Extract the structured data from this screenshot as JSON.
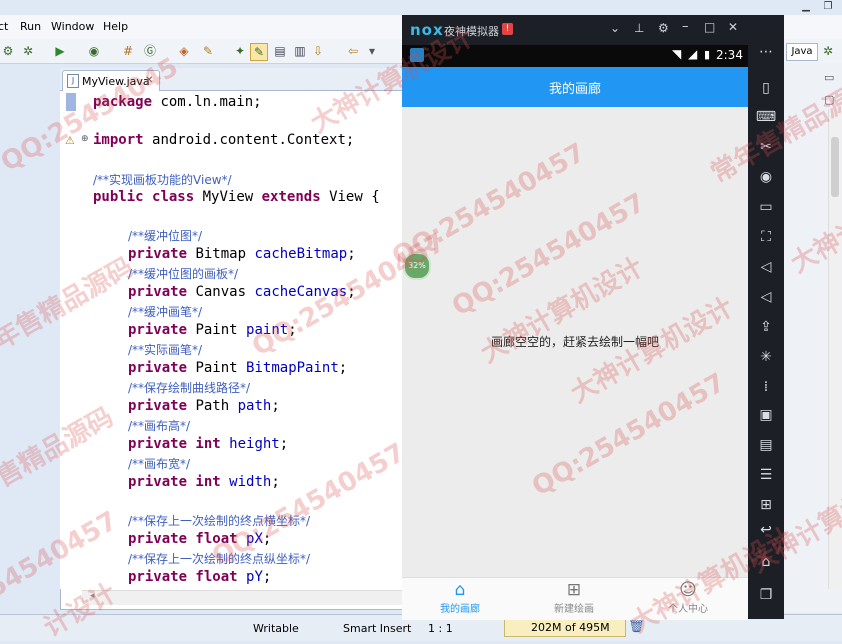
{
  "eclipse": {
    "menu": [
      "ct",
      "Run",
      "Window",
      "Help"
    ],
    "tab_label": "MyView.java",
    "tab_close": "✕",
    "perspective": "Java",
    "code": {
      "package_kw": "package",
      "package_name": "com.ln.main;",
      "import_kw": "import",
      "import_name": "android.content.Context;",
      "class_comment": "/**实现画板功能的View*/",
      "class_kw1": "public",
      "class_kw2": "class",
      "class_name": "MyView",
      "class_kw3": "extends",
      "class_rest": "View {",
      "fields": [
        {
          "comment": "/**缓冲位图*/",
          "mods": "private",
          "type": "Bitmap",
          "name": "cacheBitmap",
          "end": ";"
        },
        {
          "comment": "/**缓冲位图的画板*/",
          "mods": "private",
          "type": "Canvas",
          "name": "cacheCanvas",
          "end": ";"
        },
        {
          "comment": "/**缓冲画笔*/",
          "mods": "private",
          "type": "Paint",
          "name": "paint",
          "end": ";"
        },
        {
          "comment": "/**实际画笔*/",
          "mods": "private",
          "type": "Paint",
          "name": "BitmapPaint",
          "end": ";"
        },
        {
          "comment": "/**保存绘制曲线路径*/",
          "mods": "private",
          "type": "Path",
          "name": "path",
          "end": ";"
        },
        {
          "comment": "/**画布高*/",
          "mods": "private int",
          "type": "",
          "name": "height",
          "end": ";"
        },
        {
          "comment": "/**画布宽*/",
          "mods": "private int",
          "type": "",
          "name": "width",
          "end": ";"
        },
        {
          "comment": "/**保存上一次绘制的终点横坐标*/",
          "mods": "private float",
          "type": "",
          "name": "pX",
          "end": ";"
        },
        {
          "comment": "/**保存上一次绘制的终点纵坐标*/",
          "mods": "private float",
          "type": "",
          "name": "pY",
          "end": ";"
        }
      ]
    },
    "status": {
      "writable": "Writable",
      "insert_mode": "Smart Insert",
      "position": "1 : 1",
      "memory": "202M of 495M"
    }
  },
  "nox": {
    "logo": "nox",
    "title": "夜神模拟器",
    "badge": "!",
    "time": "2:34",
    "progress_badge": "32%"
  },
  "app": {
    "header_title": "我的画廊",
    "empty_message": "画廊空空的，赶紧去绘制一幅吧",
    "nav": [
      {
        "icon": "home-icon",
        "label": "我的画廊"
      },
      {
        "icon": "grid-icon",
        "label": "新建绘画"
      },
      {
        "icon": "user-icon",
        "label": "个人中心"
      }
    ]
  },
  "watermarks": [
    "QQ:25454045",
    "常年售精品源码",
    "大神计算机设计",
    "QQ:254540457",
    "QQ:254540457",
    "大神计算机设计",
    "常年售精品源码",
    "大神计算机设计",
    "QQ:254540457",
    "QQ:254540457",
    "大神计算机设计",
    "常年售精品源码",
    "QQ:254540457",
    "54540457",
    "大神计算机设计",
    "计设计",
    "大神计算机设计"
  ],
  "colors": {
    "keyword": "#7f0055",
    "comment": "#3f5fbf",
    "field": "#0000c0",
    "app_header": "#2196f3",
    "nox_chrome": "#1c1f26"
  }
}
